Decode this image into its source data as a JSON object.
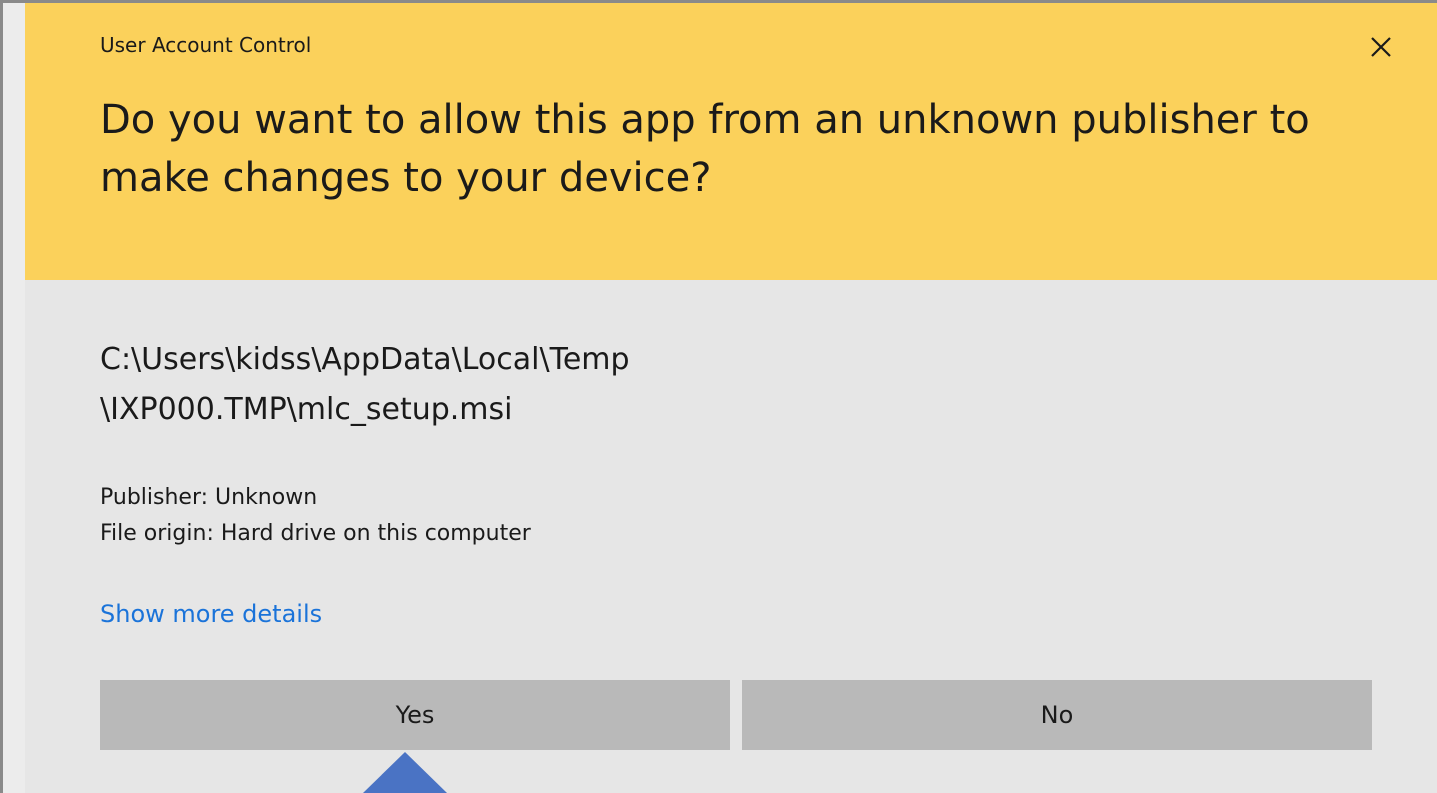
{
  "dialog": {
    "caption": "User Account Control",
    "question": "Do you want to allow this app from an unknown publisher to make changes to your device?",
    "path": "C:\\Users\\kidss\\AppData\\Local\\Temp\n\\IXP000.TMP\\mlc_setup.msi",
    "publisher": "Publisher: Unknown",
    "file_origin": "File origin: Hard drive on this computer",
    "details_link": "Show more details",
    "yes_label": "Yes",
    "no_label": "No",
    "icons": {
      "close": "close-icon",
      "pointer": "pointer-arrow-icon"
    }
  },
  "colors": {
    "header_bg": "#fbd15b",
    "body_bg": "#e6e6e6",
    "button_bg": "#b9b9b9",
    "link": "#1a73d9",
    "pointer": "#4a73c4"
  }
}
